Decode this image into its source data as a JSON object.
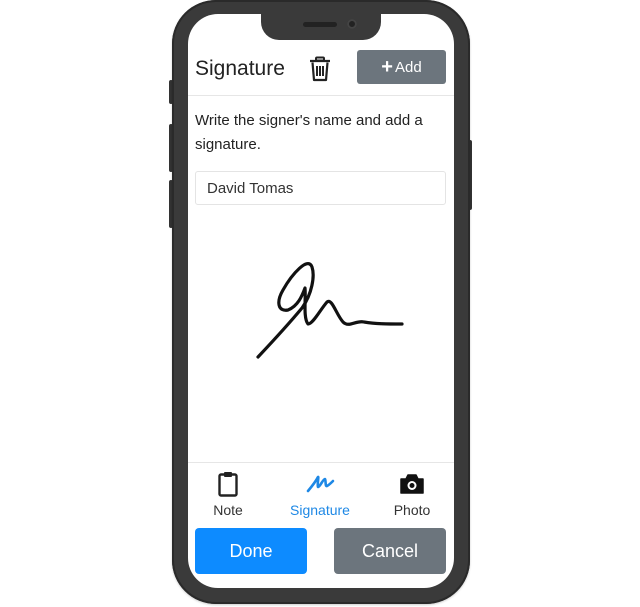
{
  "header": {
    "title": "Signature",
    "add_label": "Add",
    "delete_icon": "trash-icon",
    "add_icon": "plus-icon"
  },
  "instruction": "Write the signer's name and add a signature.",
  "signer_name": {
    "value": "David Tomas"
  },
  "signature_pad": {
    "has_signature": true,
    "ink_color": "#111111"
  },
  "tabs": [
    {
      "label": "Note",
      "icon": "clipboard-icon",
      "active": false
    },
    {
      "label": "Signature",
      "icon": "signature-icon",
      "active": true
    },
    {
      "label": "Photo",
      "icon": "camera-icon",
      "active": false
    }
  ],
  "actions": {
    "done_label": "Done",
    "cancel_label": "Cancel"
  },
  "colors": {
    "primary": "#0d8bff",
    "secondary": "#6c757d",
    "active_tab": "#1e88e5"
  }
}
